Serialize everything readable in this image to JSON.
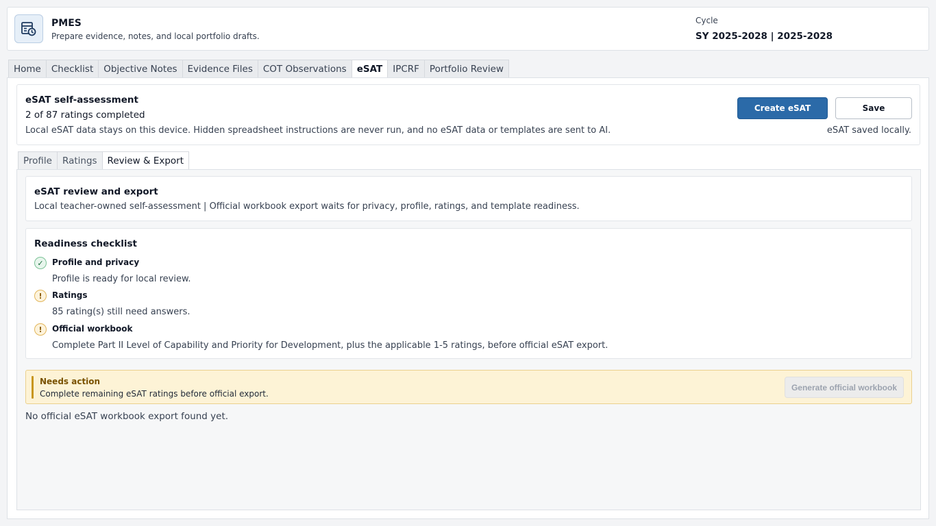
{
  "app": {
    "title": "PMES",
    "subtitle": "Prepare evidence, notes, and local portfolio drafts.",
    "logo_icon": "calendar-table-clock-icon"
  },
  "cycle": {
    "label": "Cycle",
    "value": "SY 2025-2028 | 2025-2028"
  },
  "main_tabs": [
    {
      "label": "Home",
      "active": false
    },
    {
      "label": "Checklist",
      "active": false
    },
    {
      "label": "Objective Notes",
      "active": false
    },
    {
      "label": "Evidence Files",
      "active": false
    },
    {
      "label": "COT Observations",
      "active": false
    },
    {
      "label": "eSAT",
      "active": true
    },
    {
      "label": "IPCRF",
      "active": false
    },
    {
      "label": "Portfolio Review",
      "active": false
    }
  ],
  "esat": {
    "title": "eSAT self-assessment",
    "progress": "2 of 87 ratings completed",
    "note": "Local eSAT data stays on this device. Hidden spreadsheet instructions are never run, and no eSAT data or templates are sent to AI.",
    "create_label": "Create eSAT",
    "save_label": "Save",
    "saved_status": "eSAT saved locally."
  },
  "sub_tabs": [
    {
      "label": "Profile",
      "active": false
    },
    {
      "label": "Ratings",
      "active": false
    },
    {
      "label": "Review & Export",
      "active": true
    }
  ],
  "review": {
    "title": "eSAT review and export",
    "subtitle": "Local teacher-owned self-assessment | Official workbook export waits for privacy, profile, ratings, and template readiness."
  },
  "checklist": {
    "title": "Readiness checklist",
    "items": [
      {
        "label": "Profile and privacy",
        "detail": "Profile is ready for local review.",
        "status": "ok",
        "icon": "check-icon",
        "symbol": "✓"
      },
      {
        "label": "Ratings",
        "detail": "85 rating(s) still need answers.",
        "status": "warn",
        "icon": "warning-icon",
        "symbol": "!"
      },
      {
        "label": "Official workbook",
        "detail": "Complete Part II Level of Capability and Priority for Development, plus the applicable 1-5 ratings, before official eSAT export.",
        "status": "warn",
        "icon": "warning-icon",
        "symbol": "!"
      }
    ]
  },
  "alert": {
    "title": "Needs action",
    "text": "Complete remaining eSAT ratings before official export.",
    "button_label": "Generate official workbook"
  },
  "export_status": "No official eSAT workbook export found yet.",
  "colors": {
    "primary": "#2b6aa8",
    "warning": "#c8961e",
    "success": "#176b3a"
  }
}
